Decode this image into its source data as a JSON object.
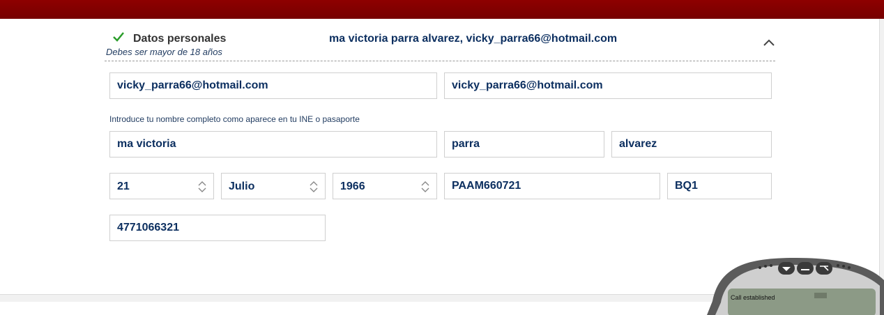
{
  "section": {
    "title": "Datos personales",
    "subtitle": "Debes ser mayor de 18 años",
    "summary": "ma victoria parra alvarez, vicky_parra66@hotmail.com"
  },
  "form": {
    "email": "vicky_parra66@hotmail.com",
    "email_confirm": "vicky_parra66@hotmail.com",
    "name_hint": "Introduce tu nombre completo como aparece en tu INE o pasaporte",
    "first_name": "ma victoria",
    "last_name_1": "parra",
    "last_name_2": "alvarez",
    "birth_day": "21",
    "birth_month": "Julio",
    "birth_year": "1966",
    "rfc": "PAAM660721",
    "homoclave": "BQ1",
    "phone": "4771066321"
  },
  "phone_widget": {
    "status": "Call established"
  },
  "colors": {
    "brand_red": "#8e0000",
    "text_navy": "#0b2e5f",
    "check_green": "#2a9d2a"
  },
  "icons": [
    "check-icon",
    "chevron-up-icon",
    "updown-icon"
  ]
}
